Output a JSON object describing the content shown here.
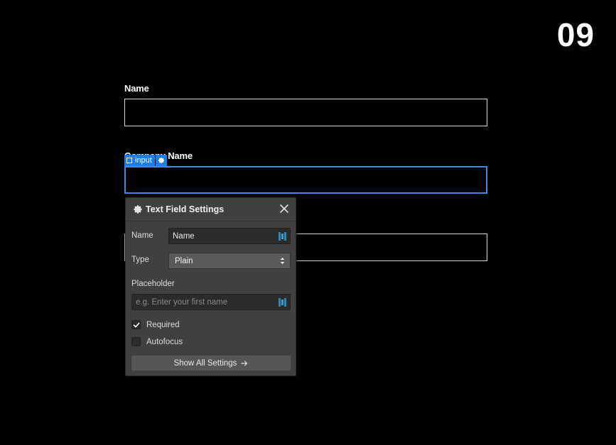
{
  "slide": {
    "number": "09"
  },
  "form": {
    "field1_label": "Name",
    "field2_label": "Company Name"
  },
  "badge": {
    "element_type": "input"
  },
  "panel": {
    "title": "Text Field Settings",
    "name_label": "Name",
    "name_value": "Name",
    "type_label": "Type",
    "type_value": "Plain",
    "placeholder_label": "Placeholder",
    "placeholder_value": "e.g. Enter your first name",
    "required_label": "Required",
    "required_checked": true,
    "autofocus_label": "Autofocus",
    "autofocus_checked": false,
    "show_all_label": "Show All Settings"
  },
  "colors": {
    "background": "#000000",
    "selection": "#1a7ee6",
    "panel_bg": "#404040",
    "bind_icon": "#3b9fd6"
  },
  "icons": {
    "gear": "gear-icon",
    "close": "close-icon",
    "bind": "database-bind-icon",
    "caret": "chevron-updown-icon",
    "check": "check-icon",
    "arrow": "arrow-right-icon"
  }
}
